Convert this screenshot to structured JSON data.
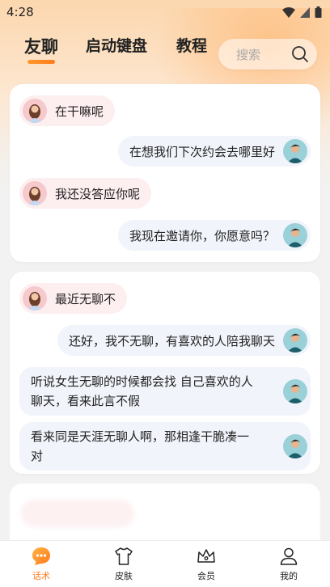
{
  "status_bar": {
    "time": "4:28"
  },
  "tabs": [
    {
      "label": "友聊",
      "active": true
    },
    {
      "label": "启动键盘",
      "active": false
    },
    {
      "label": "教程",
      "active": false
    }
  ],
  "search": {
    "placeholder": "搜索"
  },
  "cards": [
    {
      "messages": [
        {
          "side": "left",
          "text": "在干嘛呢"
        },
        {
          "side": "right",
          "text": "在想我们下次约会去哪里好"
        },
        {
          "side": "left",
          "text": "我还没答应你呢"
        },
        {
          "side": "right",
          "text": "我现在邀请你，你愿意吗？"
        }
      ]
    },
    {
      "messages": [
        {
          "side": "left",
          "text": "最近无聊不"
        },
        {
          "side": "right",
          "text": "还好，我不无聊，有喜欢的人陪我聊天"
        },
        {
          "side": "right",
          "text_line1": "听说女生无聊的时候都会找 自己喜欢的人",
          "text_line2": "聊天，看来此言不假"
        },
        {
          "side": "right",
          "text_line1": "看来同是天涯无聊人啊，那相逢干脆凑一",
          "text_line2": "对"
        }
      ]
    }
  ],
  "bottom_nav": [
    {
      "label": "话术",
      "icon": "chat-bubble-icon",
      "active": true
    },
    {
      "label": "皮肤",
      "icon": "shirt-icon",
      "active": false
    },
    {
      "label": "会员",
      "icon": "crown-icon",
      "active": false
    },
    {
      "label": "我的",
      "icon": "person-icon",
      "active": false
    }
  ],
  "colors": {
    "accent": "#ff7a1a",
    "bubble_left": "#fdeef0",
    "bubble_right": "#f1f4fa"
  }
}
